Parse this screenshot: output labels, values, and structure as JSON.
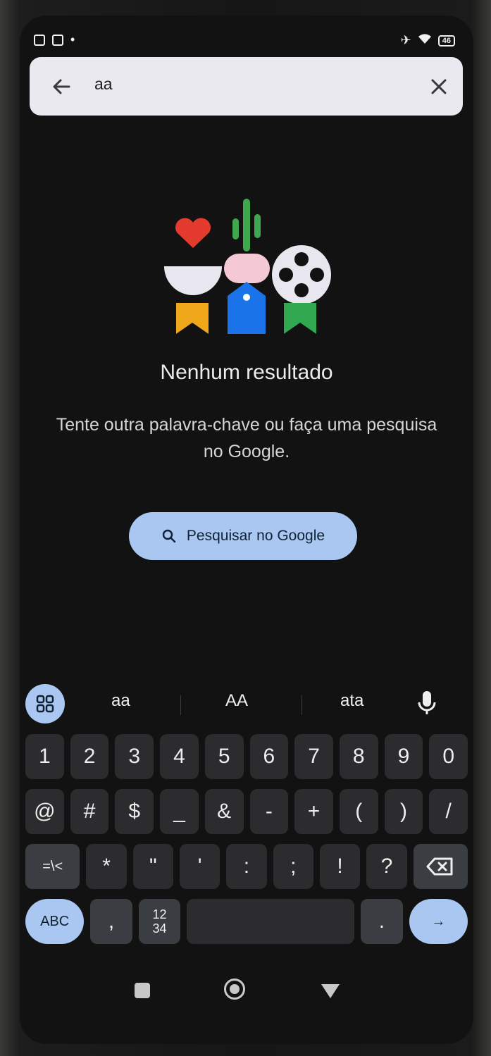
{
  "status_bar": {
    "battery": "46"
  },
  "search": {
    "query": "aa"
  },
  "empty_state": {
    "title": "Nenhum resultado",
    "subtitle": "Tente outra palavra-chave ou faça uma pesquisa no Google.",
    "button_label": "Pesquisar no Google"
  },
  "suggestions": [
    "aa",
    "AA",
    "ata"
  ],
  "keyboard": {
    "row1": [
      "1",
      "2",
      "3",
      "4",
      "5",
      "6",
      "7",
      "8",
      "9",
      "0"
    ],
    "row2": [
      "@",
      "#",
      "$",
      "_",
      "&",
      "-",
      "+",
      "(",
      ")",
      "/"
    ],
    "row3": [
      "=\\<",
      "*",
      "\"",
      "'",
      ":",
      ";",
      "!",
      "?"
    ],
    "abc_label": "ABC",
    "comma": ",",
    "num_top": "12",
    "num_bottom": "34",
    "period": ".",
    "enter": "→"
  },
  "colors": {
    "accent": "#a9c7f0",
    "background": "#121212"
  }
}
